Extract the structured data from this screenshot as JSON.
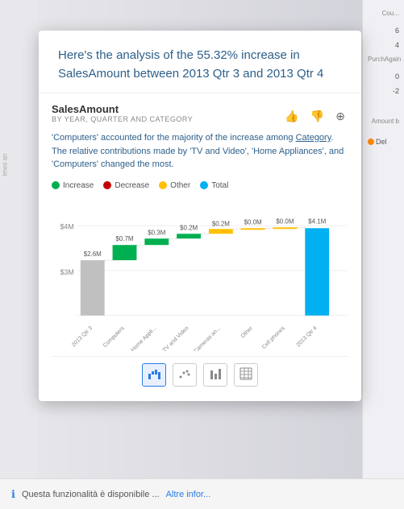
{
  "header": {
    "title": "Here's the analysis of the 55.32% increase in SalesAmount between 2013 Qtr 3 and 2013 Qtr 4"
  },
  "chart": {
    "title": "SalesAmount",
    "subtitle": "BY YEAR, QUARTER AND CATEGORY",
    "description_part1": "'Computers' accounted for the majority of the increase among",
    "description_link": "Category",
    "description_part2": ". The relative contributions made by 'TV and Video', 'Home Appliances', and 'Computers' changed the most.",
    "actions": {
      "thumbup": "👍",
      "thumbdown": "👎",
      "expand": "+"
    }
  },
  "legend": [
    {
      "label": "Increase",
      "color": "#00b050"
    },
    {
      "label": "Decrease",
      "color": "#c00000"
    },
    {
      "label": "Other",
      "color": "#ffc000"
    },
    {
      "label": "Total",
      "color": "#00b0f0"
    }
  ],
  "bars": [
    {
      "label": "2013 Qtr 3",
      "value": 2600000,
      "display": "$2.6M",
      "type": "total",
      "color": "#c0c0c0"
    },
    {
      "label": "Computers",
      "value": 700000,
      "display": "$0.7M",
      "type": "increase",
      "color": "#00b050"
    },
    {
      "label": "Home Appli...",
      "value": 300000,
      "display": "$0.3M",
      "type": "increase",
      "color": "#00b050"
    },
    {
      "label": "TV and Video",
      "value": 200000,
      "display": "$0.2M",
      "type": "increase",
      "color": "#00b050"
    },
    {
      "label": "Cameras an...",
      "value": 200000,
      "display": "$0.2M",
      "type": "other",
      "color": "#ffc000"
    },
    {
      "label": "Other",
      "value": 0,
      "display": "$0.0M",
      "type": "other",
      "color": "#ffc000"
    },
    {
      "label": "Cell phones",
      "value": 0,
      "display": "$0.0M",
      "type": "other",
      "color": "#ffc000"
    },
    {
      "label": "2013 Qtr 4",
      "value": 4100000,
      "display": "$4.1M",
      "type": "total",
      "color": "#00b0f0"
    }
  ],
  "yaxis": {
    "labels": [
      "$4M",
      "$3M"
    ],
    "max_label": "$4.1M"
  },
  "chart_type_buttons": [
    {
      "label": "📊",
      "name": "waterfall",
      "active": true
    },
    {
      "label": "⠿",
      "name": "scatter",
      "active": false
    },
    {
      "label": "📈",
      "name": "bar",
      "active": false
    },
    {
      "label": "🔢",
      "name": "table",
      "active": false
    }
  ],
  "footer": {
    "info_text": "Questa funzionalità è disponibile ...",
    "link_text": "Altre infor..."
  },
  "right_panel": {
    "labels": [
      "Cou...",
      "6",
      "4",
      "PurchAgain",
      "0",
      "-2",
      "Amount b",
      "Del"
    ]
  }
}
